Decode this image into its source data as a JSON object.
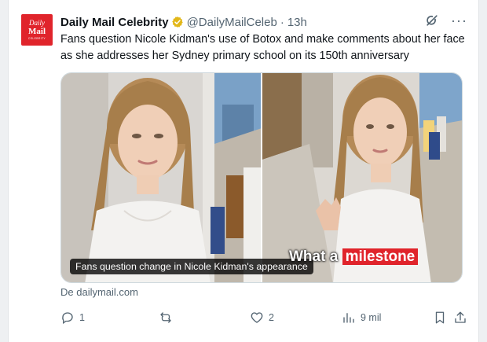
{
  "account": {
    "avatar_line1": "Daily",
    "avatar_line2": "Mail",
    "avatar_line3": "CELEBRITY",
    "display_name": "Daily Mail Celebrity",
    "handle": "@DailyMailCeleb",
    "separator": "·",
    "time": "13h",
    "verified_color": "#e2b719"
  },
  "tweet": {
    "text": "Fans question Nicole Kidman's use of Botox and make comments about her face as she addresses her Sydney primary school on its 150th anniversary"
  },
  "media": {
    "caption": "Fans question change in Nicole Kidman's appearance",
    "overlay_text_plain": "What a",
    "overlay_text_highlight": "milestone",
    "highlight_color": "#e0242b"
  },
  "source": {
    "label": "De dailymail.com"
  },
  "actions": {
    "reply_count": "1",
    "repost_count": "",
    "like_count": "2",
    "view_count": "9 mil"
  },
  "icons": {
    "grok": "grok-icon",
    "more": "more-icon",
    "reply": "reply-icon",
    "repost": "repost-icon",
    "like": "like-icon",
    "views": "views-icon",
    "bookmark": "bookmark-icon",
    "share": "share-icon"
  },
  "colors": {
    "text_primary": "#0f1419",
    "text_secondary": "#536471",
    "brand_red": "#e0242b"
  }
}
